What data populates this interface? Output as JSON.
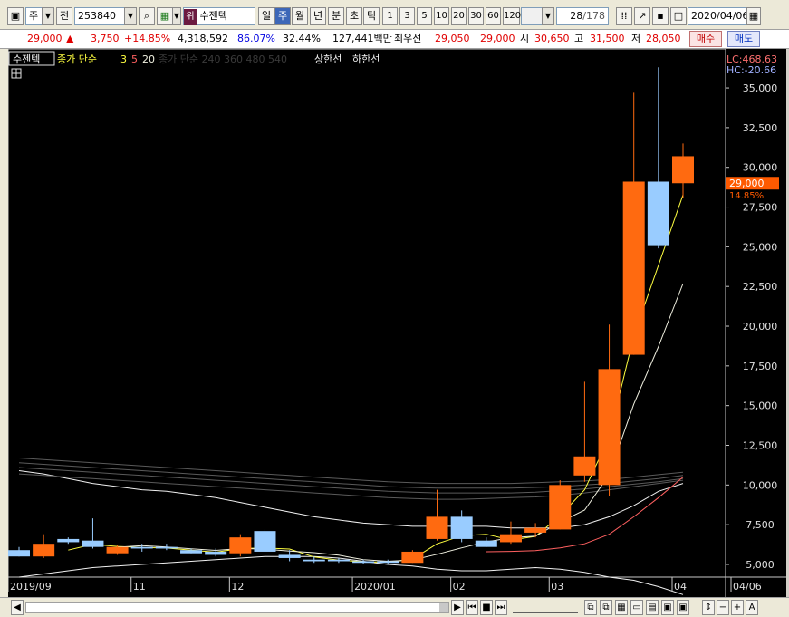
{
  "toolbar": {
    "period_select": "주",
    "prefix_label": "전",
    "code": "253840",
    "name_badge": "위",
    "name": "수젠텍",
    "periods": [
      "일",
      "주",
      "월",
      "년",
      "분",
      "초",
      "틱"
    ],
    "period_active": "주",
    "intervals": [
      "1",
      "3",
      "5",
      "10",
      "20",
      "30",
      "60",
      "120"
    ],
    "count": "28",
    "count_total": "/178",
    "date": "2020/04/06"
  },
  "quote": {
    "price": "29,000",
    "arrow": "▲",
    "change": "3,750",
    "change_pct": "+14.85%",
    "volume": "4,318,592",
    "ratio1": "86.07%",
    "ratio2": "32.44%",
    "amount": "127,441백만",
    "best_label": "최우선",
    "best_ask": "29,050",
    "best_bid": "29,000",
    "open_label": "시",
    "open": "30,650",
    "high_label": "고",
    "high": "31,500",
    "low_label": "저",
    "low": "28,050",
    "buy_label": "매수",
    "sell_label": "매도"
  },
  "legend": {
    "name": "수젠텍",
    "ma_label": "종가 단순",
    "ma_periods": [
      "3",
      "5",
      "20"
    ],
    "ma_hidden": "종가 단순 240 360 480 540",
    "upper_limit": "상한선",
    "lower_limit": "하한선",
    "lc": "LC:468.63",
    "hc": "HC:-20.66"
  },
  "chart_data": {
    "type": "candlestick",
    "ylim": [
      4200,
      37000
    ],
    "yticks": [
      5000,
      7500,
      10000,
      12500,
      15000,
      17500,
      20000,
      22500,
      25000,
      27500,
      30000,
      32500,
      35000
    ],
    "ytick_labels": [
      "5,000",
      "7,500",
      "10,000",
      "12,500",
      "15,000",
      "17,500",
      "20,000",
      "22,500",
      "25,000",
      "27,500",
      "30,000",
      "32,500",
      "35,000"
    ],
    "x_labels": [
      {
        "index": 0,
        "label": "2019/09"
      },
      {
        "index": 5,
        "label": "11"
      },
      {
        "index": 9,
        "label": "12"
      },
      {
        "index": 14,
        "label": "2020/01"
      },
      {
        "index": 18,
        "label": "02"
      },
      {
        "index": 22,
        "label": "03"
      },
      {
        "index": 27,
        "label": "04"
      },
      {
        "index": 29,
        "label": "04/06"
      }
    ],
    "current_price": 29000,
    "current_price_label": "29,000",
    "current_change_label": "14.85%",
    "candles": [
      {
        "o": 5900,
        "h": 6100,
        "l": 5500,
        "c": 5500
      },
      {
        "o": 5500,
        "h": 6900,
        "l": 5400,
        "c": 6300
      },
      {
        "o": 6600,
        "h": 6700,
        "l": 6300,
        "c": 6400
      },
      {
        "o": 6500,
        "h": 7900,
        "l": 6000,
        "c": 6100
      },
      {
        "o": 5700,
        "h": 6200,
        "l": 5600,
        "c": 6100
      },
      {
        "o": 6100,
        "h": 6300,
        "l": 5800,
        "c": 6000
      },
      {
        "o": 6100,
        "h": 6300,
        "l": 5900,
        "c": 6000
      },
      {
        "o": 5900,
        "h": 6000,
        "l": 5700,
        "c": 5700
      },
      {
        "o": 5800,
        "h": 6000,
        "l": 5500,
        "c": 5600
      },
      {
        "o": 5700,
        "h": 6900,
        "l": 5500,
        "c": 6700
      },
      {
        "o": 7100,
        "h": 7200,
        "l": 5800,
        "c": 5800
      },
      {
        "o": 5600,
        "h": 5900,
        "l": 5200,
        "c": 5400
      },
      {
        "o": 5300,
        "h": 5500,
        "l": 5100,
        "c": 5200
      },
      {
        "o": 5300,
        "h": 5400,
        "l": 5100,
        "c": 5200
      },
      {
        "o": 5200,
        "h": 5300,
        "l": 5000,
        "c": 5100
      },
      {
        "o": 5200,
        "h": 5300,
        "l": 5000,
        "c": 5100
      },
      {
        "o": 5100,
        "h": 5900,
        "l": 5100,
        "c": 5800
      },
      {
        "o": 6600,
        "h": 9700,
        "l": 6500,
        "c": 8000
      },
      {
        "o": 8000,
        "h": 8400,
        "l": 6400,
        "c": 6600
      },
      {
        "o": 6500,
        "h": 6700,
        "l": 6100,
        "c": 6100
      },
      {
        "o": 6400,
        "h": 7700,
        "l": 6300,
        "c": 6900
      },
      {
        "o": 7000,
        "h": 7600,
        "l": 6700,
        "c": 7300
      },
      {
        "o": 7200,
        "h": 10300,
        "l": 7200,
        "c": 10000
      },
      {
        "o": 10600,
        "h": 16500,
        "l": 10200,
        "c": 11800
      },
      {
        "o": 10000,
        "h": 20100,
        "l": 9300,
        "c": 17300
      },
      {
        "o": 18200,
        "h": 34700,
        "l": 18200,
        "c": 29100
      },
      {
        "o": 29100,
        "h": 36300,
        "l": 24900,
        "c": 25100
      },
      {
        "o": 29000,
        "h": 31500,
        "l": 28100,
        "c": 30700
      }
    ],
    "series": [
      {
        "name": "3",
        "color": "#ffff40",
        "values": [
          null,
          null,
          5900,
          6267,
          6133,
          6067,
          6033,
          5900,
          5767,
          6000,
          6033,
          5967,
          5467,
          5267,
          5167,
          5133,
          5333,
          6300,
          6800,
          6900,
          6533,
          6767,
          8067,
          9700,
          13033,
          19400,
          23833,
          28267
        ]
      },
      {
        "name": "5",
        "color": "#f0f0e0",
        "values": [
          null,
          null,
          null,
          null,
          6080,
          6180,
          6100,
          5980,
          5880,
          6000,
          5960,
          5840,
          5740,
          5580,
          5300,
          5200,
          5280,
          5640,
          6040,
          6420,
          6680,
          6780,
          7660,
          8420,
          10660,
          15100,
          18720,
          22680
        ]
      },
      {
        "name": "20",
        "color": "#ff6060",
        "values": [
          null,
          null,
          null,
          null,
          null,
          null,
          null,
          null,
          null,
          null,
          null,
          null,
          null,
          null,
          null,
          null,
          null,
          null,
          null,
          5800,
          5820,
          5870,
          6040,
          6300,
          6900,
          8000,
          9200,
          10500
        ]
      }
    ],
    "upper_band": [
      10900,
      10700,
      10400,
      10100,
      9900,
      9700,
      9600,
      9400,
      9200,
      8900,
      8600,
      8300,
      8000,
      7800,
      7600,
      7500,
      7400,
      7400,
      7400,
      7400,
      7300,
      7300,
      7300,
      7500,
      8000,
      8700,
      9600,
      10100
    ],
    "lower_band": [
      4200,
      4400,
      4600,
      4800,
      4900,
      5000,
      5100,
      5200,
      5300,
      5400,
      5500,
      5500,
      5500,
      5400,
      5200,
      5000,
      4900,
      4700,
      4600,
      4600,
      4700,
      4800,
      4700,
      4500,
      4200,
      4000,
      3600,
      3100
    ],
    "lt_lines": [
      {
        "values": [
          11700,
          11600,
          11500,
          11400,
          11300,
          11200,
          11100,
          11000,
          10900,
          10800,
          10700,
          10600,
          10500,
          10400,
          10300,
          10200,
          10150,
          10100,
          10100,
          10100,
          10100,
          10150,
          10200,
          10250,
          10350,
          10500,
          10650,
          10800
        ]
      },
      {
        "values": [
          11400,
          11300,
          11200,
          11100,
          11000,
          10900,
          10800,
          10700,
          10600,
          10500,
          10400,
          10300,
          10200,
          10100,
          10000,
          9900,
          9850,
          9800,
          9800,
          9800,
          9800,
          9850,
          9900,
          10000,
          10100,
          10250,
          10400,
          10600
        ]
      },
      {
        "values": [
          11100,
          11000,
          10900,
          10800,
          10700,
          10600,
          10500,
          10400,
          10300,
          10200,
          10100,
          10000,
          9900,
          9800,
          9700,
          9600,
          9550,
          9500,
          9500,
          9500,
          9500,
          9550,
          9650,
          9750,
          9900,
          10050,
          10200,
          10400
        ]
      },
      {
        "values": [
          10700,
          10600,
          10500,
          10400,
          10300,
          10200,
          10100,
          10000,
          9900,
          9800,
          9700,
          9600,
          9500,
          9400,
          9300,
          9200,
          9150,
          9100,
          9100,
          9150,
          9200,
          9250,
          9350,
          9500,
          9700,
          9900,
          10100,
          10300
        ]
      }
    ]
  }
}
